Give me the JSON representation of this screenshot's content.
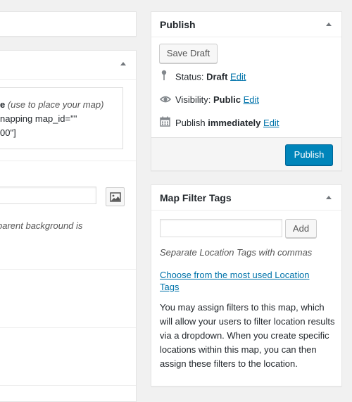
{
  "left": {
    "shortcode": {
      "title_bold": "e",
      "hint": " (use to place your map)",
      "code_line1": "napping map_id=\"\"",
      "code_line2": "00\"]"
    },
    "transparent_text": "parent background is"
  },
  "publish": {
    "title": "Publish",
    "save_draft": "Save Draft",
    "status_label": "Status: ",
    "status_value": "Draft",
    "visibility_label": "Visibility: ",
    "visibility_value": "Public",
    "publish_label": "Publish ",
    "publish_value": "immediately",
    "edit": "Edit",
    "publish_button": "Publish"
  },
  "map_filter_tags": {
    "title": "Map Filter Tags",
    "add_button": "Add",
    "tag_input_value": "",
    "howto": "Separate Location Tags with commas",
    "choose_link": "Choose from the most used Location Tags",
    "description": "You may assign filters to this map, which will allow your users to filter location results via a dropdown. When you create specific locations within this map, you can then assign these filters to the location."
  },
  "colors": {
    "accent": "#0085ba",
    "link": "#0073aa",
    "background": "#f1f1f1"
  },
  "icons": [
    "pin-icon",
    "eye-icon",
    "calendar-icon",
    "image-icon",
    "toggle-arrow-icon"
  ]
}
